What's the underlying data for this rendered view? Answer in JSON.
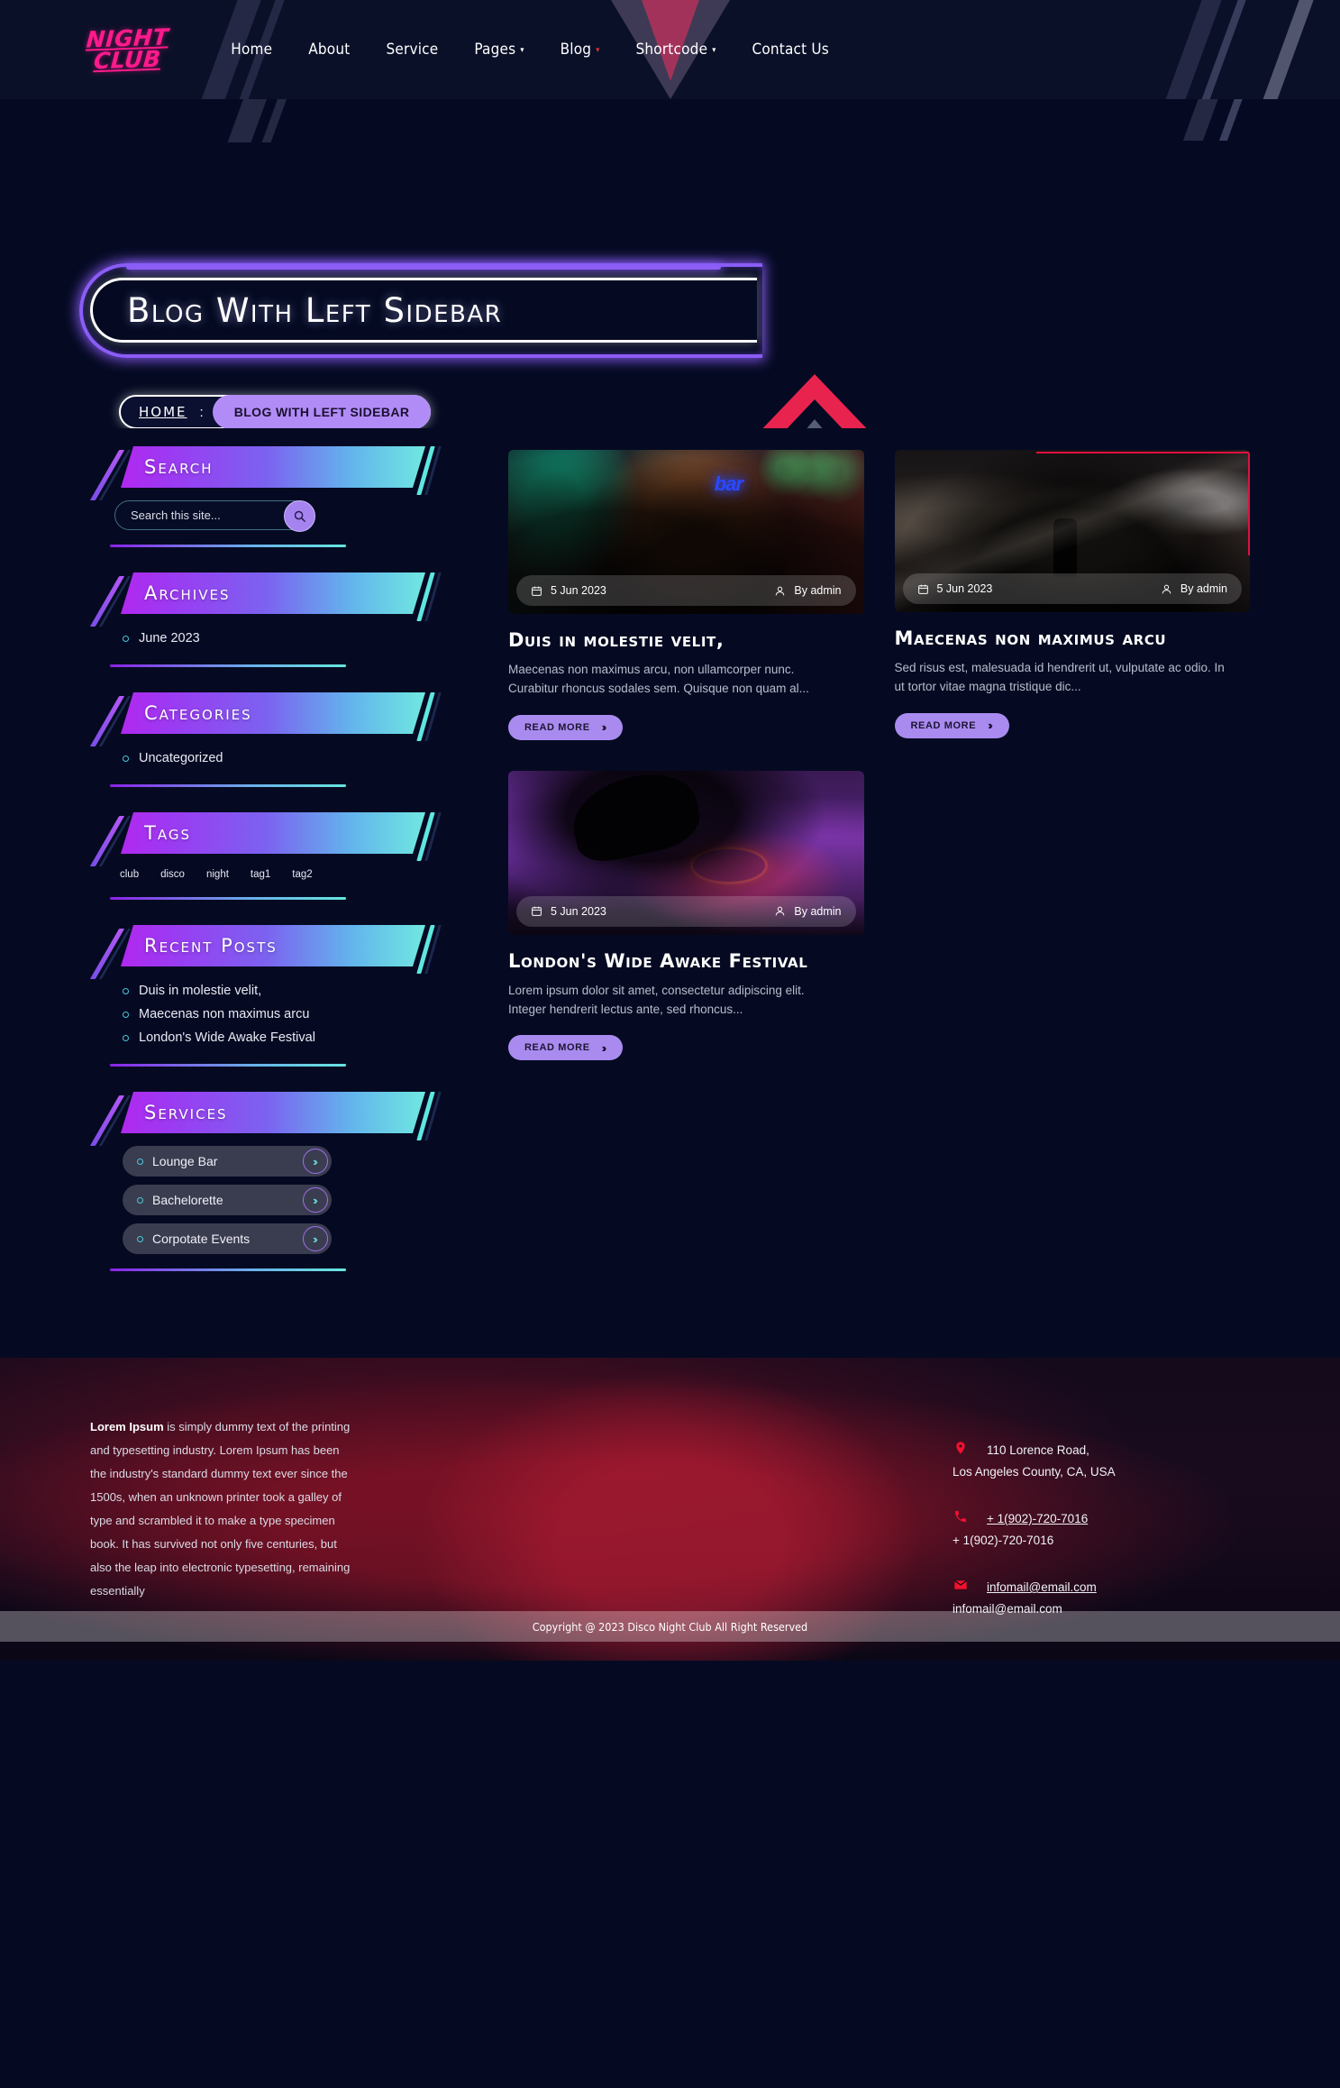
{
  "header": {
    "logo_line1": "NIGHT",
    "logo_line2": "CLUB",
    "nav": [
      {
        "label": "Home",
        "caret": false
      },
      {
        "label": "About",
        "caret": false
      },
      {
        "label": "Service",
        "caret": false
      },
      {
        "label": "Pages",
        "caret": true
      },
      {
        "label": "Blog",
        "caret": true
      },
      {
        "label": "Shortcode",
        "caret": true
      },
      {
        "label": "Contact Us",
        "caret": false
      }
    ]
  },
  "hero": {
    "page_title": "Blog With Left Sidebar",
    "breadcrumb_home": "HOME",
    "breadcrumb_sep": ":",
    "breadcrumb_current": "BLOG WITH LEFT SIDEBAR"
  },
  "sidebar": {
    "search": {
      "title": "Search",
      "placeholder": "Search this site...",
      "value": "",
      "icon": "search-icon"
    },
    "archives": {
      "title": "Archives",
      "items": [
        "June 2023"
      ]
    },
    "categories": {
      "title": "Categories",
      "items": [
        "Uncategorized"
      ]
    },
    "tags": {
      "title": "Tags",
      "items": [
        "club",
        "disco",
        "night",
        "tag1",
        "tag2"
      ]
    },
    "recent_posts": {
      "title": "Recent Posts",
      "items": [
        "Duis in molestie velit,",
        "Maecenas non maximus arcu",
        "London's Wide Awake Festival"
      ]
    },
    "services": {
      "title": "Services",
      "items": [
        "Lounge Bar",
        "Bachelorette",
        "Corpotate Events"
      ],
      "arrow_icon": "double-chevron-right-icon"
    }
  },
  "posts": [
    {
      "date": "5 Jun 2023",
      "author": "By admin",
      "title": "Duis in molestie velit,",
      "excerpt": "Maecenas non maximus arcu, non ullamcorper nunc. Curabitur rhoncus sodales sem. Quisque non quam al...",
      "read_more": "READ MORE",
      "image_caption": "bar",
      "style": "plain"
    },
    {
      "date": "5 Jun 2023",
      "author": "By admin",
      "title": "Maecenas non maximus arcu",
      "excerpt": "Sed risus est, malesuada id hendrerit ut, vulputate ac odio. In ut tortor vitae magna tristique dic...",
      "read_more": "READ MORE",
      "image_caption": "",
      "style": "redframe"
    },
    {
      "date": "5 Jun 2023",
      "author": "By admin",
      "title": "London's Wide Awake Festival",
      "excerpt": "Lorem ipsum dolor sit amet, consectetur adipiscing elit. Integer hendrerit lectus ante, sed rhoncus...",
      "read_more": "READ MORE",
      "image_caption": "",
      "style": "plain"
    }
  ],
  "footer": {
    "about_strong": "Lorem Ipsum",
    "about_text": " is simply dummy text of the printing and typesetting industry. Lorem Ipsum has been the industry's standard dummy text ever since the 1500s, when an unknown printer took a galley of type and scrambled it to make a type specimen book. It has survived not only five centuries, but also the leap into electronic typesetting, remaining essentially",
    "address_line1": "110 Lorence Road,",
    "address_line2": "Los Angeles County, CA, USA",
    "phone_line1": "+ 1(902)-720-7016",
    "phone_line2": "+ 1(902)-720-7016",
    "email_line1": "infomail@email.com",
    "email_line2": "infomail@email.com",
    "copyright": "Copyright @ 2023 Disco Night Club All Right Reserved",
    "icons": {
      "location": "location-pin-icon",
      "phone": "phone-icon",
      "email": "envelope-icon"
    }
  },
  "colors": {
    "accent_pink": "#ff1a8c",
    "accent_purple": "#8b5cf6",
    "accent_cyan": "#6fe8e0",
    "accent_red": "#e8244e",
    "bg_dark": "#050a22"
  }
}
